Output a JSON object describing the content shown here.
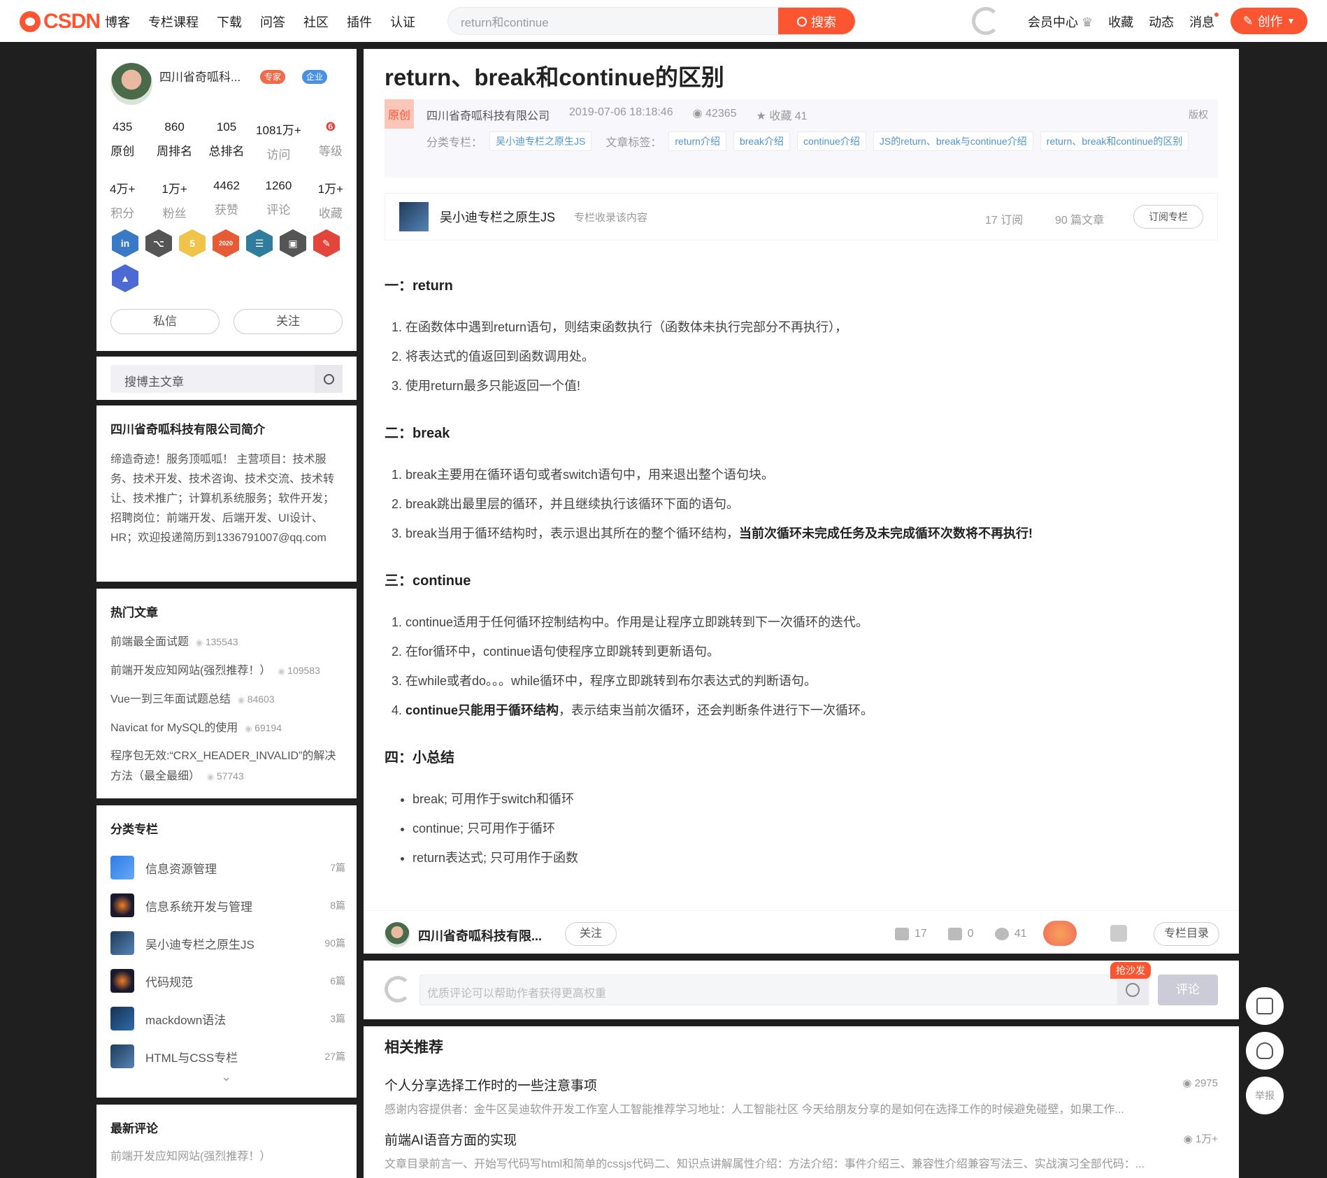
{
  "topnav": {
    "logo": "CSDN",
    "links": [
      "博客",
      "专栏课程",
      "下载",
      "问答",
      "社区",
      "插件",
      "认证"
    ],
    "search_placeholder": "return和continue",
    "search_button": "搜索",
    "right_links": [
      "会员中心",
      "收藏",
      "动态",
      "消息"
    ],
    "create_button": "创作"
  },
  "profile": {
    "name": "四川省奇呱科...",
    "badges": [
      "专家",
      "企业"
    ],
    "stats_row1": [
      {
        "value": "435",
        "label": "原创"
      },
      {
        "value": "860",
        "label": "周排名"
      },
      {
        "value": "105",
        "label": "总排名"
      },
      {
        "value": "1081万+",
        "label": "访问"
      },
      {
        "value": "",
        "label": "等级"
      }
    ],
    "stats_row2": [
      {
        "value": "4万+",
        "label": "积分"
      },
      {
        "value": "1万+",
        "label": "粉丝"
      },
      {
        "value": "4462",
        "label": "获赞"
      },
      {
        "value": "1260",
        "label": "评论"
      },
      {
        "value": "1万+",
        "label": "收藏"
      }
    ],
    "medal_colors": [
      "#3a79c6",
      "#555555",
      "#f0c34a",
      "#e55b35",
      "#2f7d9e",
      "#555555",
      "#e2453c",
      "#4b6ad3"
    ],
    "medal_2020_label": "2020",
    "message_button": "私信",
    "follow_button": "关注"
  },
  "side_search": {
    "placeholder": "搜博主文章"
  },
  "intro": {
    "title": "四川省奇呱科技有限公司简介",
    "text": "缔造奇迹！服务顶呱呱！ 主营项目：技术服务、技术开发、技术咨询、技术交流、技术转让、技术推广；计算机系统服务；软件开发； 招聘岗位：前端开发、后端开发、UI设计、HR；欢迎投递简历到1336791007@qq.com"
  },
  "hot_articles": {
    "title": "热门文章",
    "items": [
      {
        "title": "前端最全面试题",
        "views": "135543"
      },
      {
        "title": "前端开发应知网站(强烈推荐！）",
        "views": "109583"
      },
      {
        "title": "Vue一到三年面试题总结",
        "views": "84603"
      },
      {
        "title": "Navicat for MySQL的使用",
        "views": "69194"
      },
      {
        "title": "程序包无效:“CRX_HEADER_INVALID”的解决方法（最全最细）",
        "views": "57743"
      }
    ]
  },
  "categories": {
    "title": "分类专栏",
    "items": [
      {
        "name": "信息资源管理",
        "count": "7篇"
      },
      {
        "name": "信息系统开发与管理",
        "count": "8篇"
      },
      {
        "name": "吴小迪专栏之原生JS",
        "count": "90篇"
      },
      {
        "name": "代码规范",
        "count": "6篇"
      },
      {
        "name": "mackdown语法",
        "count": "3篇"
      },
      {
        "name": "HTML与CSS专栏",
        "count": "27篇"
      }
    ]
  },
  "latest_comments": {
    "title": "最新评论",
    "first": "前端开发应知网站(强烈推荐！）"
  },
  "article": {
    "title": "return、break和continue的区别",
    "original_tag": "原创",
    "author": "四川省奇呱科技有限公司",
    "date": "2019-07-06 18:18:46",
    "views": "42365",
    "favorites": "收藏 41",
    "copyright": "版权",
    "category_label": "分类专栏：",
    "category": "吴小迪专栏之原生JS",
    "tags_label": "文章标签：",
    "tags": [
      "return介绍",
      "break介绍",
      "continue介绍",
      "JS的return、break与continue介绍",
      "return、break和continue的区别"
    ]
  },
  "column_box": {
    "name": "吴小迪专栏之原生JS",
    "tip": "专栏收录该内容",
    "subs": "17 订阅",
    "articles": "90 篇文章",
    "subscribe_button": "订阅专栏"
  },
  "content": {
    "s1_title": "一：return",
    "s1_items": [
      "在函数体中遇到return语句，则结束函数执行（函数体未执行完部分不再执行），",
      "将表达式的值返回到函数调用处。",
      "使用return最多只能返回一个值!"
    ],
    "s2_title": "二：break",
    "s2_items": [
      "break主要用在循环语句或者switch语句中，用来退出整个语句块。",
      "break跳出最里层的循环，并且继续执行该循环下面的语句。"
    ],
    "s2_item3_text": "break当用于循环结构时，表示退出其所在的整个循环结构，",
    "s2_item3_bold": "当前次循环未完成任务及未完成循环次数将不再执行!",
    "s3_title": "三：continue",
    "s3_items": [
      "continue适用于任何循环控制结构中。作用是让程序立即跳转到下一次循环的迭代。",
      "在for循环中，continue语句使程序立即跳转到更新语句。",
      "在while或者do。。。while循环中，程序立即跳转到布尔表达式的判断语句。"
    ],
    "s3_item4_bold": "continue只能用于循环结构",
    "s3_item4_text": "，表示结束当前次循环，还会判断条件进行下一次循环。",
    "s4_title": "四：小总结",
    "s4_items": [
      "break; 可用作于switch和循环",
      "continue; 只可用作于循环",
      "return表达式; 只可用作于函数"
    ]
  },
  "article_footer": {
    "author": "四川省奇呱科技有限...",
    "follow": "关注",
    "likes": "17",
    "comments": "0",
    "favorites": "41",
    "toc_button": "专栏目录"
  },
  "comment_bar": {
    "placeholder": "优质评论可以帮助作者获得更高权重",
    "sofa_badge": "抢沙发",
    "submit": "评论"
  },
  "recommend": {
    "title": "相关推荐",
    "items": [
      {
        "title": "个人分享选择工作时的一些注意事项",
        "desc": "感谢内容提供者：金牛区吴迪软件开发工作室人工智能推荐学习地址：人工智能社区     今天给朋友分享的是如何在选择工作的时候避免碰壁，如果工作...",
        "views": "2975"
      },
      {
        "title": "前端AI语音方面的实现",
        "desc": "文章目录前言一、开始写代码写html和简单的cssjs代码二、知识点讲解属性介绍：方法介绍：事件介绍三、兼容性介绍兼容写法三、实战演习全部代码：...",
        "views": "1万+"
      }
    ]
  },
  "float_tools": {
    "report": "举报"
  }
}
